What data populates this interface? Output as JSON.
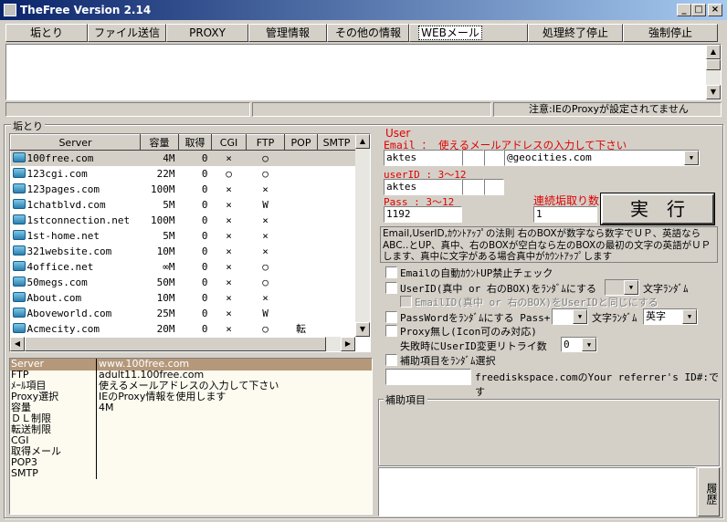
{
  "window": {
    "title": "TheFree Version 2.14",
    "minimize": "_",
    "maximize": "□",
    "close": "×"
  },
  "toolbar": [
    "垢とり",
    "ファイル送信",
    "PROXY",
    "管理情報",
    "その他の情報",
    "WEBメール",
    "処理終了停止",
    "強制停止"
  ],
  "status": {
    "left": "",
    "middle": "",
    "right": "注意:IEのProxyが設定されてません"
  },
  "group_title": "垢とり",
  "server_list": {
    "columns": [
      "Server",
      "容量",
      "取得",
      "CGI",
      "FTP",
      "POP",
      "SMTP"
    ],
    "rows": [
      [
        "100free.com",
        "4M",
        "0",
        "×",
        "○",
        "",
        ""
      ],
      [
        "123cgi.com",
        "22M",
        "0",
        "○",
        "○",
        "",
        ""
      ],
      [
        "123pages.com",
        "100M",
        "0",
        "×",
        "×",
        "",
        ""
      ],
      [
        "1chatblvd.com",
        "5M",
        "0",
        "×",
        "W",
        "",
        ""
      ],
      [
        "1stconnection.net",
        "100M",
        "0",
        "×",
        "×",
        "",
        ""
      ],
      [
        "1st-home.net",
        "5M",
        "0",
        "×",
        "×",
        "",
        ""
      ],
      [
        "321website.com",
        "10M",
        "0",
        "×",
        "×",
        "",
        ""
      ],
      [
        "4office.net",
        "∞M",
        "0",
        "×",
        "○",
        "",
        ""
      ],
      [
        "50megs.com",
        "50M",
        "0",
        "×",
        "○",
        "",
        ""
      ],
      [
        "About.com",
        "10M",
        "0",
        "×",
        "×",
        "",
        ""
      ],
      [
        "Aboveworld.com",
        "25M",
        "0",
        "×",
        "W",
        "",
        ""
      ],
      [
        "Acmecity.com",
        "20M",
        "0",
        "×",
        "○",
        "転",
        ""
      ]
    ]
  },
  "details": [
    [
      "Server",
      "www.100free.com"
    ],
    [
      "FTP",
      "adult11.100free.com"
    ],
    [
      "ﾒｰﾙ項目",
      "使えるメールアドレスの入力して下さい"
    ],
    [
      "Proxy選択",
      "IEのProxy情報を使用します"
    ],
    [
      "容量",
      "4M"
    ],
    [
      "ＤＬ制限",
      ""
    ],
    [
      "転送制限",
      ""
    ],
    [
      "CGI",
      ""
    ],
    [
      "取得メール",
      ""
    ],
    [
      "POP3",
      ""
    ],
    [
      "SMTP",
      ""
    ]
  ],
  "form": {
    "user_label": "User",
    "email_label": "Email ： 使えるメールアドレスの入力して下さい",
    "email_value": "aktes",
    "domain_value": "@geocities.com",
    "userid_label": "userID : 3〜12",
    "userid_value": "aktes",
    "pass_label": "Pass : 3〜12",
    "pass_value": "1192",
    "count_label": "連続垢取り数",
    "count_value": "1",
    "run_button": "実　行",
    "info_text": "Email,UserID,ｶｳﾝﾄｱｯﾌﾟの法則 右のBOXが数字なら数字でＵＰ、英語ならABC‥とUP、真中、右のBOXが空白なら左のBOXの最初の文字の英語がＵＰします、真中に文字がある場合真中がｶｳﾝﾄｱｯﾌﾟします",
    "chk_email_auto": "Emailの自動ｶｳﾝﾄUP禁止チェック",
    "chk_userid_random": "UserID(真中 or 右のBOX)をﾗﾝﾀﾞﾑにする",
    "random_char_label1": "文字ﾗﾝﾀﾞﾑ",
    "chk_emailid_same": "EmailID(真中 or 右のBOX)をUserIDと同じにする",
    "chk_pass_random": "PassWordをﾗﾝﾀﾞﾑにする Pass+",
    "random_char_label2": "文字ﾗﾝﾀﾞﾑ",
    "random_type": "英字",
    "chk_no_proxy": "Proxy無し(Icon可のみ対応)",
    "retry_label": "失敗時にUserID変更リトライ数",
    "retry_value": "0",
    "chk_aux_random": "補助項目をﾗﾝﾀﾞﾑ選択",
    "referrer_value": "",
    "referrer_label": "freediskspace.comのYour referrer's ID#:です",
    "aux_group": "補助項目",
    "history_button": "履歴"
  }
}
